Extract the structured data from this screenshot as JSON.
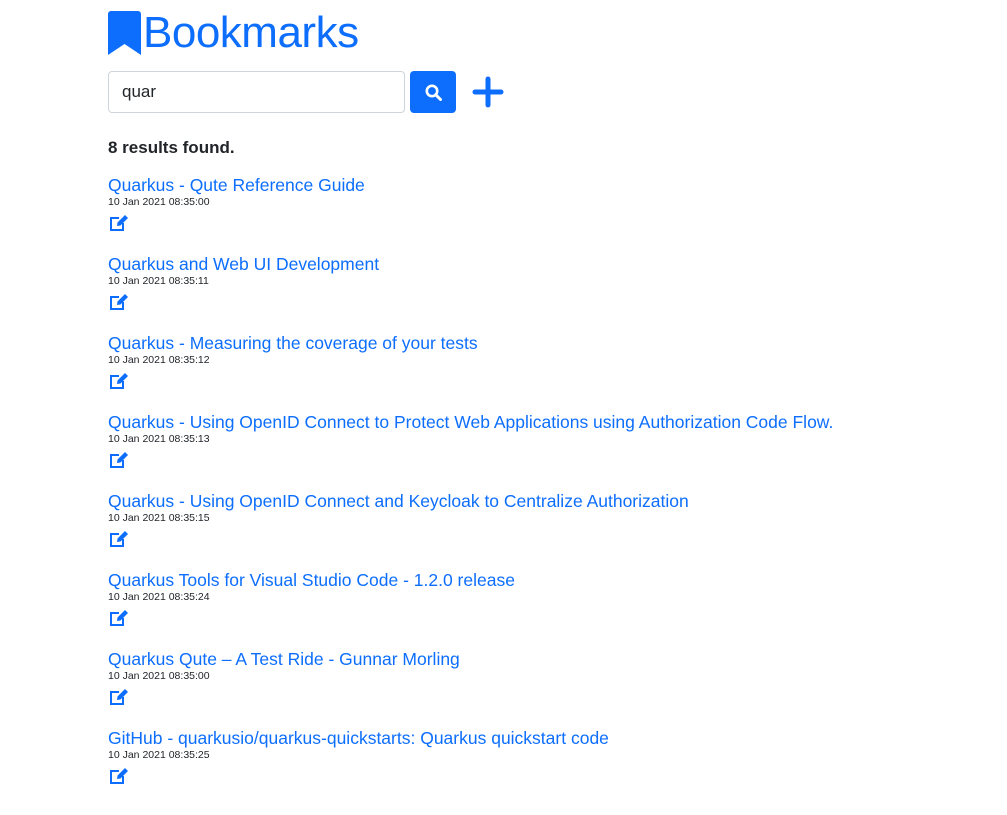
{
  "header": {
    "title": "Bookmarks",
    "logo_icon": "bookmark-icon",
    "accent_color": "#0d6efd"
  },
  "search": {
    "value": "quar",
    "placeholder": "",
    "button_icon": "search-icon",
    "add_icon": "plus-icon"
  },
  "results": {
    "summary": "8 results found.",
    "items": [
      {
        "title": "Quarkus - Qute Reference Guide",
        "date": "10 Jan 2021 08:35:00",
        "edit_icon": "edit-icon"
      },
      {
        "title": "Quarkus and Web UI Development",
        "date": "10 Jan 2021 08:35:11",
        "edit_icon": "edit-icon"
      },
      {
        "title": "Quarkus - Measuring the coverage of your tests",
        "date": "10 Jan 2021 08:35:12",
        "edit_icon": "edit-icon"
      },
      {
        "title": "Quarkus - Using OpenID Connect to Protect Web Applications using Authorization Code Flow.",
        "date": "10 Jan 2021 08:35:13",
        "edit_icon": "edit-icon"
      },
      {
        "title": "Quarkus - Using OpenID Connect and Keycloak to Centralize Authorization",
        "date": "10 Jan 2021 08:35:15",
        "edit_icon": "edit-icon"
      },
      {
        "title": "Quarkus Tools for Visual Studio Code - 1.2.0 release",
        "date": "10 Jan 2021 08:35:24",
        "edit_icon": "edit-icon"
      },
      {
        "title": "Quarkus Qute – A Test Ride - Gunnar Morling",
        "date": "10 Jan 2021 08:35:00",
        "edit_icon": "edit-icon"
      },
      {
        "title": "GitHub - quarkusio/quarkus-quickstarts: Quarkus quickstart code",
        "date": "10 Jan 2021 08:35:25",
        "edit_icon": "edit-icon"
      }
    ]
  }
}
